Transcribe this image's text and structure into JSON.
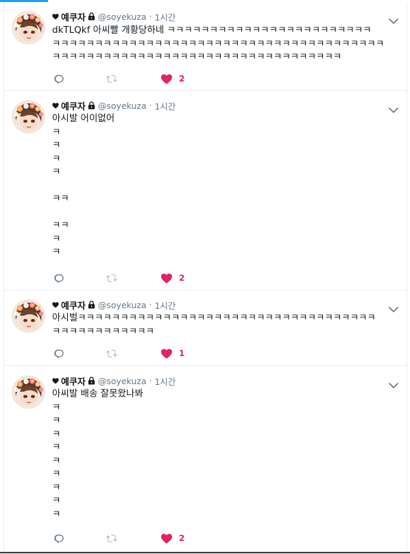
{
  "user": {
    "display_name": "예쿠자",
    "handle": "@soyekuza",
    "separator": "·"
  },
  "colors": {
    "accent": "#1da1f2",
    "like": "#e0245e",
    "meta": "#657786",
    "border": "#e6ecf0"
  },
  "tweets": [
    {
      "time": "1시간",
      "lines": [
        "dkTLQkf 아씨빨 개황당하네 ㅋㅋㅋㅋㅋㅋㅋㅋㅋㅋㅋㅋㅋㅋㅋㅋㅋㅋㅋㅋㅋㅋㅋㅋ",
        "ㅋㅋㅋㅋㅋㅋㅋㅋㅋㅋㅋㅋㅋㅋㅋㅋㅋㅋㅋㅋㅋㅋㅋㅋㅋㅋㅋㅋㅋㅋㅋㅋㅋㅋㅋㅋㅋㅋㅋ",
        "ㅋㅋㅋㅋㅋㅋㅋㅋㅋㅋㅋㅋㅋㅋㅋㅋㅋㅋㅋㅋㅋㅋㅋㅋㅋㅋㅋㅋㅋㅋㅋㅋㅋㅋ"
      ],
      "likes": "2"
    },
    {
      "time": "1시간",
      "lines": [
        "아시발 어이없어",
        "ㅋ",
        "ㅋ",
        "ㅋ",
        "ㅋ",
        "",
        "ㅋㅋ",
        "",
        "ㅋㅋ",
        "ㅋ",
        "ㅋ"
      ],
      "likes": "2"
    },
    {
      "time": "1시간",
      "lines": [
        "아시벌ㅋㅋㅋㅋㅋㅋㅋㅋㅋㅋㅋㅋㅋㅋㅋㅋㅋㅋㅋㅋㅋㅋㅋㅋㅋㅋㅋㅋㅋㅋㅋㅋㅋㅋㅋ",
        "ㅋㅋㅋㅋㅋㅋㅋㅋㅋㅋㅋㅋ"
      ],
      "likes": "1"
    },
    {
      "time": "1시간",
      "lines": [
        "아씨발 배송 잘못왔나봐",
        "ㅋ",
        "ㅋ",
        "ㅋ",
        "ㅋ",
        "ㅋ",
        "ㅋ",
        "ㅋ",
        "ㅋ",
        "ㅋ"
      ],
      "likes": "2"
    }
  ]
}
